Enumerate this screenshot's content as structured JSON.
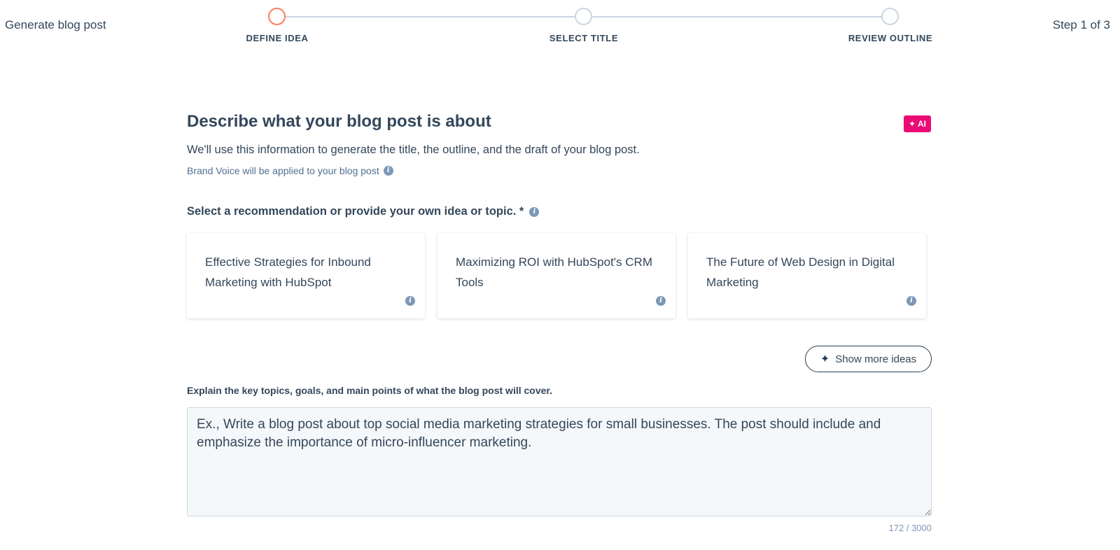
{
  "header": {
    "title": "Generate blog post",
    "step_count": "Step 1 of 3"
  },
  "stepper": {
    "steps": [
      {
        "label": "DEFINE IDEA",
        "active": true
      },
      {
        "label": "SELECT TITLE",
        "active": false
      },
      {
        "label": "REVIEW OUTLINE",
        "active": false
      }
    ]
  },
  "main": {
    "heading": "Describe what your blog post is about",
    "ai_badge": "✦ AI",
    "subtext": "We'll use this information to generate the title, the outline, and the draft of your blog post.",
    "brand_voice": "Brand Voice will be applied to your blog post",
    "select_label": "Select a recommendation or provide your own idea or topic. *",
    "recommendations": [
      {
        "text": "Effective Strategies for Inbound Marketing with HubSpot"
      },
      {
        "text": "Maximizing ROI with HubSpot's CRM Tools"
      },
      {
        "text": "The Future of Web Design in Digital Marketing"
      }
    ],
    "show_more_label": "Show more ideas",
    "explain_label": "Explain the key topics, goals, and main points of what the blog post will cover.",
    "textarea_placeholder": "Ex., Write a blog post about top social media marketing strategies for small businesses. The post should include and emphasize the importance of micro-influencer marketing.",
    "char_count": "172 / 3000"
  },
  "colors": {
    "accent_active_step": "#ff7a59",
    "ai_badge": "#ea0b74",
    "text": "#33475b"
  },
  "icons": {
    "info": "info-icon",
    "sparkle": "sparkle-icon"
  }
}
